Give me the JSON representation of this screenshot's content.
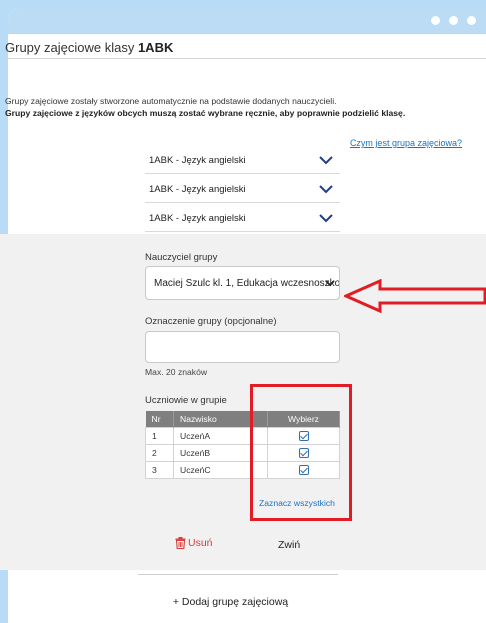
{
  "window": {
    "dots": [
      "dot",
      "dot",
      "dot"
    ]
  },
  "heading": {
    "prefix": "Grupy zajęciowe klasy ",
    "class_name": "1ABK"
  },
  "info": {
    "line1": "Grupy zajęciowe zostały stworzone automatycznie na podstawie dodanych nauczycieli.",
    "line2": "Grupy zajęciowe z języków obcych muszą zostać wybrane ręcznie, aby poprawnie podzielić klasę."
  },
  "help_link": "Czym jest grupa zajęciowa?",
  "groups": [
    {
      "label": "1ABK - Język angielski",
      "icon": "chevron-down-icon"
    },
    {
      "label": "1ABK - Język angielski",
      "icon": "chevron-down-icon"
    },
    {
      "label": "1ABK - Język angielski",
      "icon": "chevron-down-icon"
    }
  ],
  "editor": {
    "teacher_label": "Nauczyciel grupy",
    "teacher_value": "Maciej Szulc kl. 1, Edukacja wczesnoszkolna",
    "designation_label": "Oznaczenie grupy (opcjonalne)",
    "designation_value": "",
    "designation_hint": "Max. 20 znaków",
    "students_label": "Uczniowie w grupie",
    "table": {
      "headers": [
        "Nr",
        "Nazwisko",
        "Wybierz"
      ],
      "rows": [
        {
          "nr": "1",
          "name": "UczeńA",
          "checked": true
        },
        {
          "nr": "2",
          "name": "UczeńB",
          "checked": true
        },
        {
          "nr": "3",
          "name": "UczeńC",
          "checked": true
        }
      ]
    },
    "select_all": "Zaznacz wszystkich",
    "delete_label": "Usuń",
    "collapse_label": "Zwiń"
  },
  "add_group": "+ Dodaj grupę zajęciową",
  "colors": {
    "accent": "#1a73c7",
    "annotation": "#e11c24",
    "delete": "#d63c3c",
    "table_header": "#7f7f7f",
    "background": "#b9dcf6"
  }
}
